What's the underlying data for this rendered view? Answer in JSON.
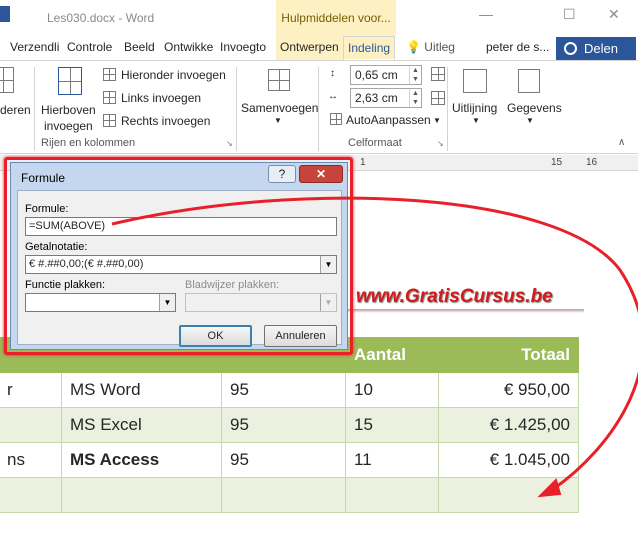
{
  "window": {
    "doc_title": "Les030.docx - Word",
    "context_group": "Hulpmiddelen voor...",
    "minimize": "—",
    "restore": "☐",
    "close": "✕"
  },
  "tabs": [
    "Verzendli",
    "Controle",
    "Beeld",
    "Ontwikke",
    "Invoegto",
    "Ontwerpen",
    "Indeling"
  ],
  "tell_me": "Uitleg",
  "user_name": "peter de s...",
  "share_label": "Delen",
  "ribbon": {
    "delete_partial": "deren",
    "insert_above": "Hierboven",
    "insert_above_2": "invoegen",
    "insert_below": "Hieronder invoegen",
    "insert_left": "Links invoegen",
    "insert_right": "Rechts invoegen",
    "rows_cols_group": "Rijen en kolommen",
    "merge": "Samenvoegen",
    "height_value": "0,65 cm",
    "width_value": "2,63 cm",
    "autofit": "AutoAanpassen",
    "cell_size_group": "Celformaat",
    "alignment": "Uitlijning",
    "data": "Gegevens"
  },
  "ruler": {
    "left_mark": "1",
    "mid_mark": "15",
    "right_mark": "16"
  },
  "dialog": {
    "title": "Formule",
    "help": "?",
    "close": "✕",
    "formula_label": "Formule:",
    "formula_value": "=SUM(ABOVE)",
    "number_format_label": "Getalnotatie:",
    "number_format_value": "€ #.##0,00;(€ #.##0,00)",
    "paste_function_label": "Functie plakken:",
    "paste_bookmark_label": "Bladwijzer plakken:",
    "ok": "OK",
    "cancel": "Annuleren"
  },
  "watermark": "www.GratisCursus.be",
  "table": {
    "headers": [
      "",
      "",
      "",
      "Aantal",
      "Totaal"
    ],
    "rows": [
      [
        "r",
        "MS Word",
        "95",
        "10",
        "€  950,00"
      ],
      [
        "",
        "MS Excel",
        "95",
        "15",
        "€ 1.425,00"
      ],
      [
        "ns",
        "MS Access",
        "95",
        "11",
        "€ 1.045,00"
      ],
      [
        "",
        "",
        "",
        "",
        ""
      ]
    ]
  },
  "colors": {
    "accent": "#2b579a",
    "table_header": "#9bbb59",
    "table_band": "#ebf1de",
    "annotation_red": "#e8202a"
  }
}
